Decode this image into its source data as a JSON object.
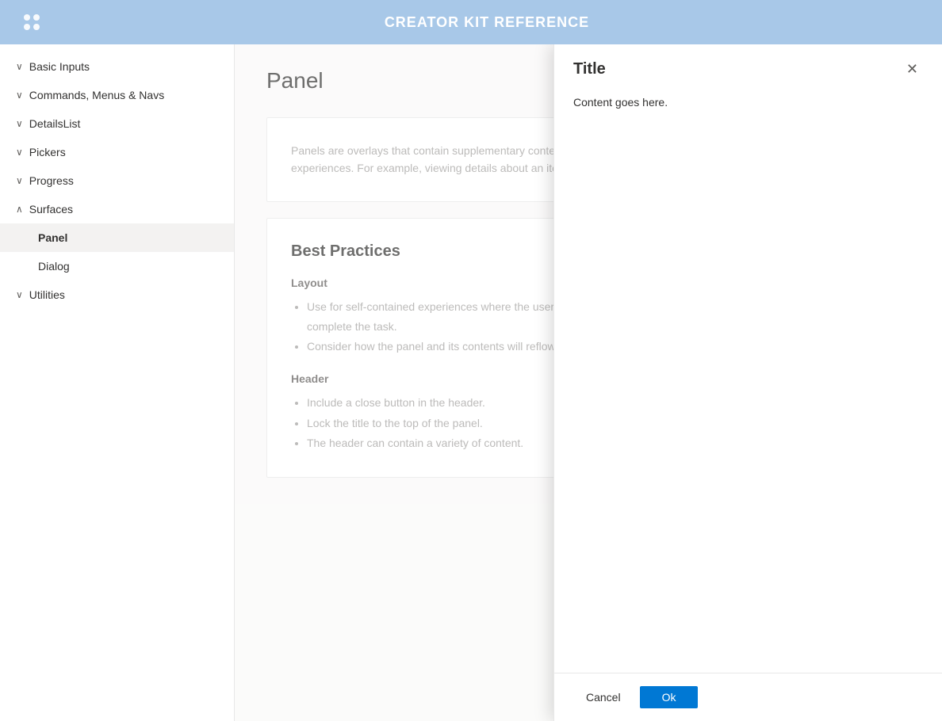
{
  "topbar": {
    "title": "CREATOR KIT REFERENCE",
    "logo_alt": "logo"
  },
  "sidebar": {
    "items": [
      {
        "id": "basic-inputs",
        "label": "Basic Inputs",
        "chevron": "∨",
        "expanded": false
      },
      {
        "id": "commands-menus-navs",
        "label": "Commands, Menus & Navs",
        "chevron": "∨",
        "expanded": false
      },
      {
        "id": "details-list",
        "label": "DetailsList",
        "chevron": "∨",
        "expanded": false
      },
      {
        "id": "pickers",
        "label": "Pickers",
        "chevron": "∨",
        "expanded": false
      },
      {
        "id": "progress",
        "label": "Progress",
        "chevron": "∨",
        "expanded": false
      },
      {
        "id": "surfaces",
        "label": "Surfaces",
        "chevron": "∧",
        "expanded": true
      },
      {
        "id": "utilities",
        "label": "Utilities",
        "chevron": "∨",
        "expanded": false
      }
    ],
    "surfaces_children": [
      {
        "id": "panel",
        "label": "Panel",
        "active": true
      },
      {
        "id": "dialog",
        "label": "Dialog",
        "active": false
      }
    ]
  },
  "content": {
    "page_title": "Panel",
    "description": "Panels are overlays that contain supplementary content and are used for self-contained creation, edit, or management experiences. For example, viewing details about an item in a list or editing settings.",
    "best_practices_heading": "Best Practices",
    "layout_heading": "Layout",
    "layout_items": [
      "Use for self-contained experiences where the user needs to view or edit content without leaving the app view to complete the task.",
      "Consider how the panel and its contents will reflow across different screen sizes and web breakpoints."
    ],
    "header_heading": "Header",
    "header_items": [
      "Include a close button in the header.",
      "Lock the title to the top of the panel.",
      "The header can contain a variety of content."
    ]
  },
  "dialog": {
    "title": "Title",
    "content": "Content goes here.",
    "cancel_label": "Cancel",
    "ok_label": "Ok",
    "close_icon": "✕"
  }
}
